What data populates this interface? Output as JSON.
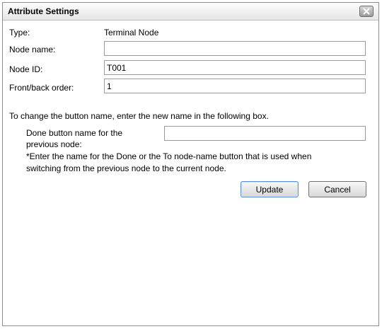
{
  "dialog": {
    "title": "Attribute Settings",
    "close_icon": "close-icon"
  },
  "form": {
    "type_label": "Type:",
    "type_value": "Terminal Node",
    "node_name_label": "Node name:",
    "node_name_value": "",
    "node_id_label": "Node ID:",
    "node_id_value": "T001",
    "front_back_label": "Front/back order:",
    "front_back_value": "1"
  },
  "button_name": {
    "instruction": "To change the button name, enter the new name in the following box.",
    "done_label_line1": "Done button name for the",
    "done_label_line2": "previous node:",
    "done_value": "",
    "note_line1": "*Enter the name for the Done or the To node-name button that is used when",
    "note_line2": "switching from the previous node to the current node."
  },
  "buttons": {
    "update": "Update",
    "cancel": "Cancel"
  },
  "colors": {
    "titlebar": "#e6e6e6",
    "primary_button_border": "#5a8fd8",
    "field_border": "#9a9a9a"
  }
}
